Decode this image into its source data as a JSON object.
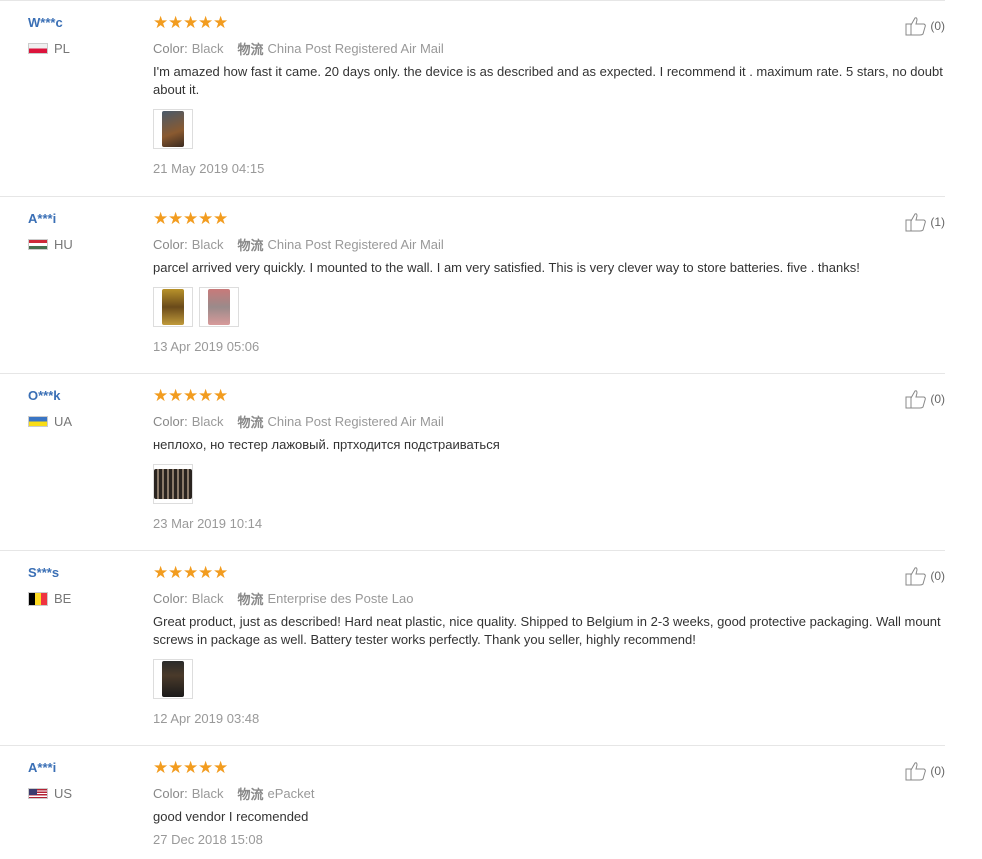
{
  "labels": {
    "color": "Color:",
    "shipping": "物流"
  },
  "reviews": [
    {
      "user": "W***c",
      "country": "PL",
      "flag": "pl",
      "rating": 5,
      "color": "Black",
      "shipping": "China Post Registered Air Mail",
      "text": "I'm amazed how fast it came. 20 days only. the device is as described and as expected. I recommend it . maximum rate. 5 stars, no doubt about it.",
      "photos": 1,
      "date": "21 May 2019 04:15",
      "helpful": "(0)"
    },
    {
      "user": "A***i",
      "country": "HU",
      "flag": "hu",
      "rating": 5,
      "color": "Black",
      "shipping": "China Post Registered Air Mail",
      "text": "parcel arrived very quickly. I mounted to the wall. I am very satisfied. This is very clever way to store batteries. five . thanks!",
      "photos": 2,
      "date": "13 Apr 2019 05:06",
      "helpful": "(1)"
    },
    {
      "user": "O***k",
      "country": "UA",
      "flag": "ua",
      "rating": 5,
      "color": "Black",
      "shipping": "China Post Registered Air Mail",
      "text": "неплохо, но тестер лажовый. пртходится подстраиваться",
      "photos": 1,
      "date": "23 Mar 2019 10:14",
      "helpful": "(0)"
    },
    {
      "user": "S***s",
      "country": "BE",
      "flag": "be",
      "rating": 5,
      "color": "Black",
      "shipping": "Enterprise des Poste Lao",
      "text": "Great product, just as described! Hard neat plastic, nice quality. Shipped to Belgium in 2-3 weeks, good protective packaging. Wall mount screws in package as well. Battery tester works perfectly. Thank you seller, highly recommend!",
      "photos": 1,
      "date": "12 Apr 2019 03:48",
      "helpful": "(0)"
    },
    {
      "user": "A***i",
      "country": "US",
      "flag": "us",
      "rating": 5,
      "color": "Black",
      "shipping": "ePacket",
      "text": "good vendor I recomended",
      "photos": 0,
      "date": "27 Dec 2018 15:08",
      "helpful": "(0)"
    }
  ],
  "colors": {
    "star": "#f29c1f",
    "username": "#3a6fb5"
  }
}
